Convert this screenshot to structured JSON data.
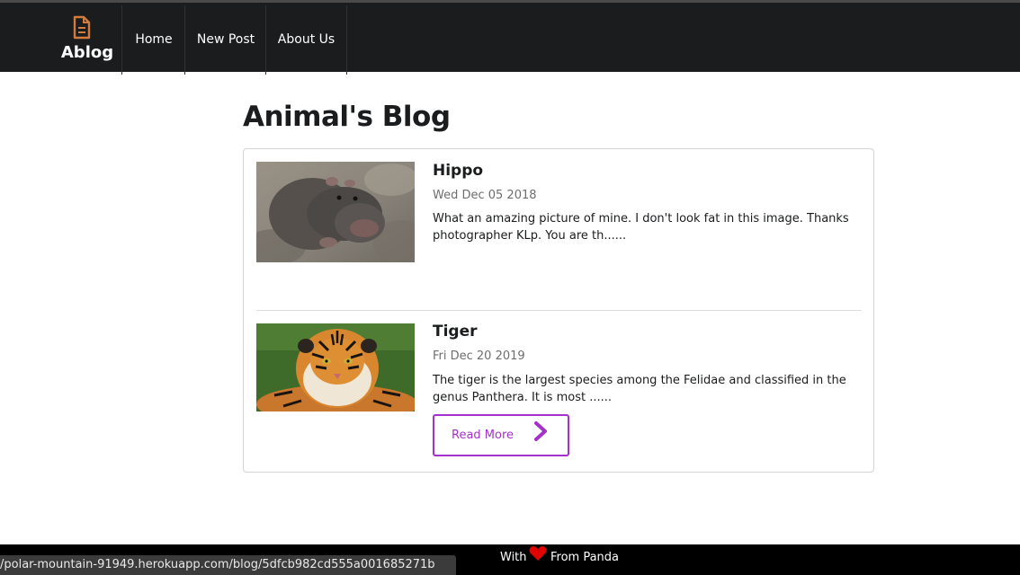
{
  "nav": {
    "brand": "Ablog",
    "brand_icon": "document-icon",
    "items": [
      {
        "label": "Home"
      },
      {
        "label": "New Post"
      },
      {
        "label": "About Us"
      }
    ]
  },
  "page": {
    "title": "Animal's Blog"
  },
  "posts": [
    {
      "title": "Hippo",
      "date": "Wed Dec 05 2018",
      "excerpt": "What an amazing picture of mine. I don't look fat in this image. Thanks photographer KLp. You are th......"
    },
    {
      "title": "Tiger",
      "date": "Fri Dec 20 2019",
      "excerpt": "The tiger is the largest species among the Felidae and classified in the genus Panthera. It is most ......",
      "read_more": "Read More"
    }
  ],
  "footer": {
    "with": "With",
    "from": "From Panda",
    "heart_icon": "heart-icon"
  },
  "status_url": "/polar-mountain-91949.herokuapp.com/blog/5dfcb982cd555a001685271b",
  "colors": {
    "nav_bg": "#1b1c1d",
    "accent": "#a333c8",
    "brand_icon": "#d27b3e",
    "heart": "#e00000"
  }
}
